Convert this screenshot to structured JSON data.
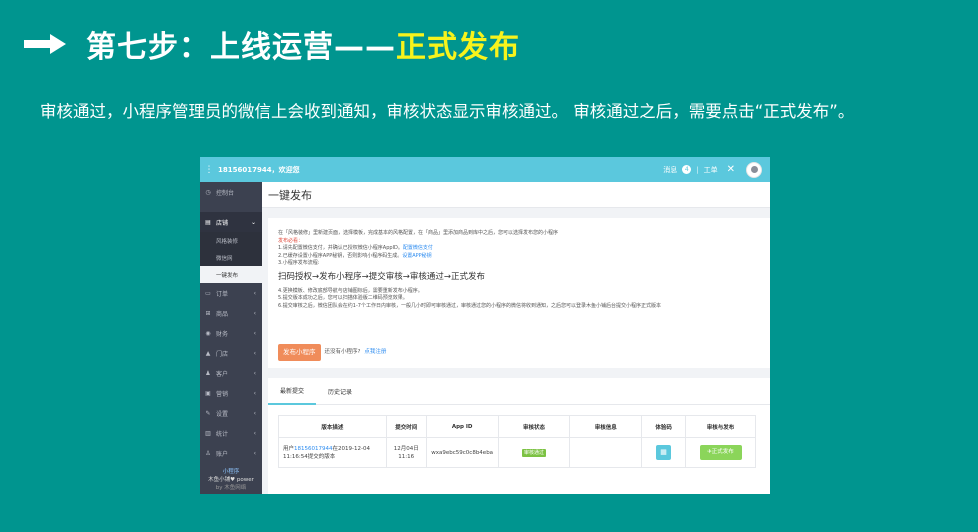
{
  "slide": {
    "title": "第七步：上线运营——",
    "title_highlight": "正式发布",
    "description": "审核通过，小程序管理员的微信上会收到通知，审核状态显示审核通过。 审核通过之后，需要点击“正式发布”。"
  },
  "screenshot": {
    "topbar": {
      "menu_icon": "⋮",
      "account": "18156017944，欢迎您",
      "messages_label": "消息",
      "messages_count": "4",
      "separator": "|",
      "ticket_label": "工单",
      "close_icon": "✕"
    },
    "sidebar": {
      "items": [
        {
          "icon": "◷",
          "label": "控制台"
        },
        {
          "icon": "▤",
          "label": "店铺",
          "chevron": "⌄"
        },
        {
          "icon": "▭",
          "label": "订单",
          "chevron": "‹"
        },
        {
          "icon": "⊞",
          "label": "商品",
          "chevron": "‹"
        },
        {
          "icon": "◉",
          "label": "财务",
          "chevron": "‹"
        },
        {
          "icon": "▲",
          "label": "门店",
          "chevron": "‹"
        },
        {
          "icon": "♟",
          "label": "客户",
          "chevron": "‹"
        },
        {
          "icon": "▣",
          "label": "营销",
          "chevron": "‹"
        },
        {
          "icon": "✎",
          "label": "设置",
          "chevron": "‹"
        },
        {
          "icon": "▥",
          "label": "统计",
          "chevron": "‹"
        },
        {
          "icon": "♙",
          "label": "账户",
          "chevron": "‹"
        }
      ],
      "sub_items": [
        "风格装修",
        "微信网",
        "一键发布"
      ],
      "footer": [
        "小程序",
        "木鱼小铺♥ power",
        "by 木鱼网络"
      ]
    },
    "page_title": "一键发布",
    "notice": {
      "intro": "在「风格装修」里新建页面，选择模板，完成基本的风格配置，在「商品」里添加商品到库中之后，您可以选择发布您的小程序",
      "warning_label": "发布必看：",
      "step1": "1.请先配置微信支付，并确认已授权微信小程序AppID。",
      "step1_link": "配置微信支付",
      "step2": "2.已缓存设置小程序APP秘钥，否则影响小程序码生成。",
      "step2_link": "设置APP秘钥",
      "step3": "3.小程序发布流程:",
      "flow": "扫码授权→发布小程序→提交审核→审核通过→正式发布",
      "note4": "4.更换模板、修改底部导航与店铺图标后，需要重新发布小程序。",
      "note5": "5.提交版本成功之后，您可以扫描体验版二维码预览效果。",
      "note6": "6.提交审核之后，微信团队会在约1-7个工作日内审核，一般几小时即可审核通过，审核通过您的小程序的微信将收到通知，之后您可以登录木鱼小铺后台提交小程序正式版本"
    },
    "publish": {
      "button": "发布小程序",
      "no_app_text": "还没有小程序?",
      "register_link": "点我注册"
    },
    "tabs": [
      "最新提交",
      "历史记录"
    ],
    "table": {
      "headers": [
        "版本描述",
        "提交时间",
        "App ID",
        "审核状态",
        "审核信息",
        "体验码",
        "审核与发布"
      ],
      "row": {
        "desc_prefix": "用户",
        "desc_account": "18156017944",
        "desc_suffix": "在2019-12-04 11:16:54提交的版本",
        "time_line1": "12月04日",
        "time_line2": "11:16",
        "app_id": "wxa9ebc59c0c8b4eba",
        "status": "审核通过",
        "info": "",
        "qr_icon": "▦",
        "release_button": "✈正式发布"
      }
    }
  }
}
